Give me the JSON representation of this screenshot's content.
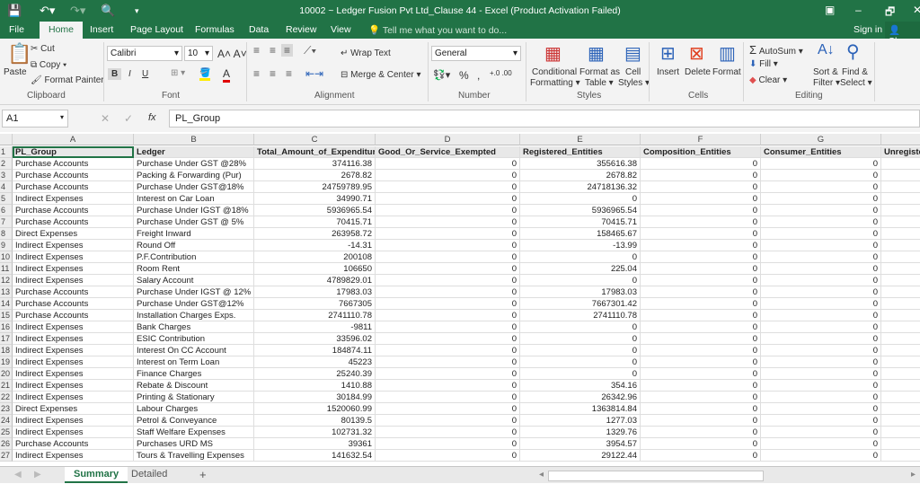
{
  "titlebar": {
    "title": "10002 ~ Ledger Fusion Pvt Ltd_Clause 44 - Excel (Product Activation Failed)",
    "minimize": "–",
    "restore": "🗗",
    "close": "✕"
  },
  "menu": {
    "tabs": [
      "File",
      "Home",
      "Insert",
      "Page Layout",
      "Formulas",
      "Data",
      "Review",
      "View"
    ],
    "active": "Home",
    "tell_me": "Tell me what you want to do...",
    "sign_in": "Sign in",
    "share": "Share"
  },
  "ribbon": {
    "clipboard": {
      "paste": "Paste",
      "cut": "Cut",
      "copy": "Copy",
      "format_painter": "Format Painter",
      "label": "Clipboard"
    },
    "font": {
      "name": "Calibri",
      "size": "10",
      "bold": "B",
      "italic": "I",
      "underline": "U",
      "label": "Font"
    },
    "alignment": {
      "wrap": "Wrap Text",
      "merge": "Merge & Center",
      "label": "Alignment"
    },
    "number": {
      "format": "General",
      "percent": "%",
      "comma": ",",
      "label": "Number"
    },
    "styles": {
      "conditional": "Conditional",
      "conditional2": "Formatting",
      "format_table": "Format as",
      "format_table2": "Table",
      "cell_styles": "Cell",
      "cell_styles2": "Styles",
      "label": "Styles"
    },
    "cells": {
      "insert": "Insert",
      "delete": "Delete",
      "format": "Format",
      "label": "Cells"
    },
    "editing": {
      "autosum": "AutoSum",
      "fill": "Fill",
      "clear": "Clear",
      "sort": "Sort &",
      "sort2": "Filter",
      "find": "Find &",
      "find2": "Select",
      "label": "Editing"
    }
  },
  "formula_bar": {
    "name_box": "A1",
    "value": "PL_Group",
    "cancel": "✕",
    "enter": "✓",
    "fx": "fx"
  },
  "sheet": {
    "columns": [
      "A",
      "B",
      "C",
      "D",
      "E",
      "F",
      "G",
      "H"
    ],
    "headers": [
      "PL_Group",
      "Ledger",
      "Total_Amount_of_Expenditure",
      "Good_Or_Service_Exempted",
      "Registered_Entities",
      "Composition_Entities",
      "Consumer_Entities",
      "Unregiste"
    ],
    "rows": [
      [
        "Purchase Accounts",
        "Purchase  Under GST @28%",
        "374116.38",
        "0",
        "355616.38",
        "0",
        "0"
      ],
      [
        "Purchase Accounts",
        "Packing & Forwarding (Pur)",
        "2678.82",
        "0",
        "2678.82",
        "0",
        "0"
      ],
      [
        "Purchase Accounts",
        "Purchase Under GST@18%",
        "24759789.95",
        "0",
        "24718136.32",
        "0",
        "0"
      ],
      [
        "Indirect Expenses",
        "Interest on Car Loan",
        "34990.71",
        "0",
        "0",
        "0",
        "0"
      ],
      [
        "Purchase Accounts",
        "Purchase Under IGST @18%",
        "5936965.54",
        "0",
        "5936965.54",
        "0",
        "0"
      ],
      [
        "Purchase Accounts",
        "Purchase Under GST @ 5%",
        "70415.71",
        "0",
        "70415.71",
        "0",
        "0"
      ],
      [
        "Direct Expenses",
        "Freight Inward",
        "263958.72",
        "0",
        "158465.67",
        "0",
        "0"
      ],
      [
        "Indirect Expenses",
        "Round Off",
        "-14.31",
        "0",
        "-13.99",
        "0",
        "0"
      ],
      [
        "Indirect Expenses",
        "P.F.Contribution",
        "200108",
        "0",
        "0",
        "0",
        "0"
      ],
      [
        "Indirect Expenses",
        "Room Rent",
        "106650",
        "0",
        "225.04",
        "0",
        "0"
      ],
      [
        "Indirect Expenses",
        "Salary Account",
        "4789829.01",
        "0",
        "0",
        "0",
        "0"
      ],
      [
        "Purchase Accounts",
        "Purchase Under IGST @ 12%",
        "17983.03",
        "0",
        "17983.03",
        "0",
        "0"
      ],
      [
        "Purchase Accounts",
        "Purchase Under GST@12%",
        "7667305",
        "0",
        "7667301.42",
        "0",
        "0"
      ],
      [
        "Purchase Accounts",
        "Installation  Charges Exps.",
        "2741110.78",
        "0",
        "2741110.78",
        "0",
        "0"
      ],
      [
        "Indirect Expenses",
        "Bank Charges",
        "-9811",
        "0",
        "0",
        "0",
        "0"
      ],
      [
        "Indirect Expenses",
        "ESIC Contribution",
        "33596.02",
        "0",
        "0",
        "0",
        "0"
      ],
      [
        "Indirect Expenses",
        "Interest On CC Account",
        "184874.11",
        "0",
        "0",
        "0",
        "0"
      ],
      [
        "Indirect Expenses",
        "Interest on Term Loan",
        "45223",
        "0",
        "0",
        "0",
        "0"
      ],
      [
        "Indirect Expenses",
        "Finance Charges",
        "25240.39",
        "0",
        "0",
        "0",
        "0"
      ],
      [
        "Indirect Expenses",
        "Rebate & Discount",
        "1410.88",
        "0",
        "354.16",
        "0",
        "0"
      ],
      [
        "Indirect Expenses",
        "Printing & Stationary",
        "30184.99",
        "0",
        "26342.96",
        "0",
        "0"
      ],
      [
        "Direct Expenses",
        "Labour Charges",
        "1520060.99",
        "0",
        "1363814.84",
        "0",
        "0"
      ],
      [
        "Indirect Expenses",
        "Petrol  & Conveyance",
        "80139.5",
        "0",
        "1277.03",
        "0",
        "0"
      ],
      [
        "Indirect Expenses",
        "Staff Welfare Expenses",
        "102731.32",
        "0",
        "1329.76",
        "0",
        "0"
      ],
      [
        "Purchase Accounts",
        "Purchases URD MS",
        "39361",
        "0",
        "3954.57",
        "0",
        "0"
      ],
      [
        "Indirect Expenses",
        "Tours & Travelling Expenses",
        "141632.54",
        "0",
        "29122.44",
        "0",
        "0"
      ]
    ]
  },
  "sheet_tabs": {
    "tabs": [
      "Summary",
      "Detailed"
    ],
    "active": "Summary",
    "add": "+"
  },
  "colors": {
    "accent": "#217346"
  }
}
